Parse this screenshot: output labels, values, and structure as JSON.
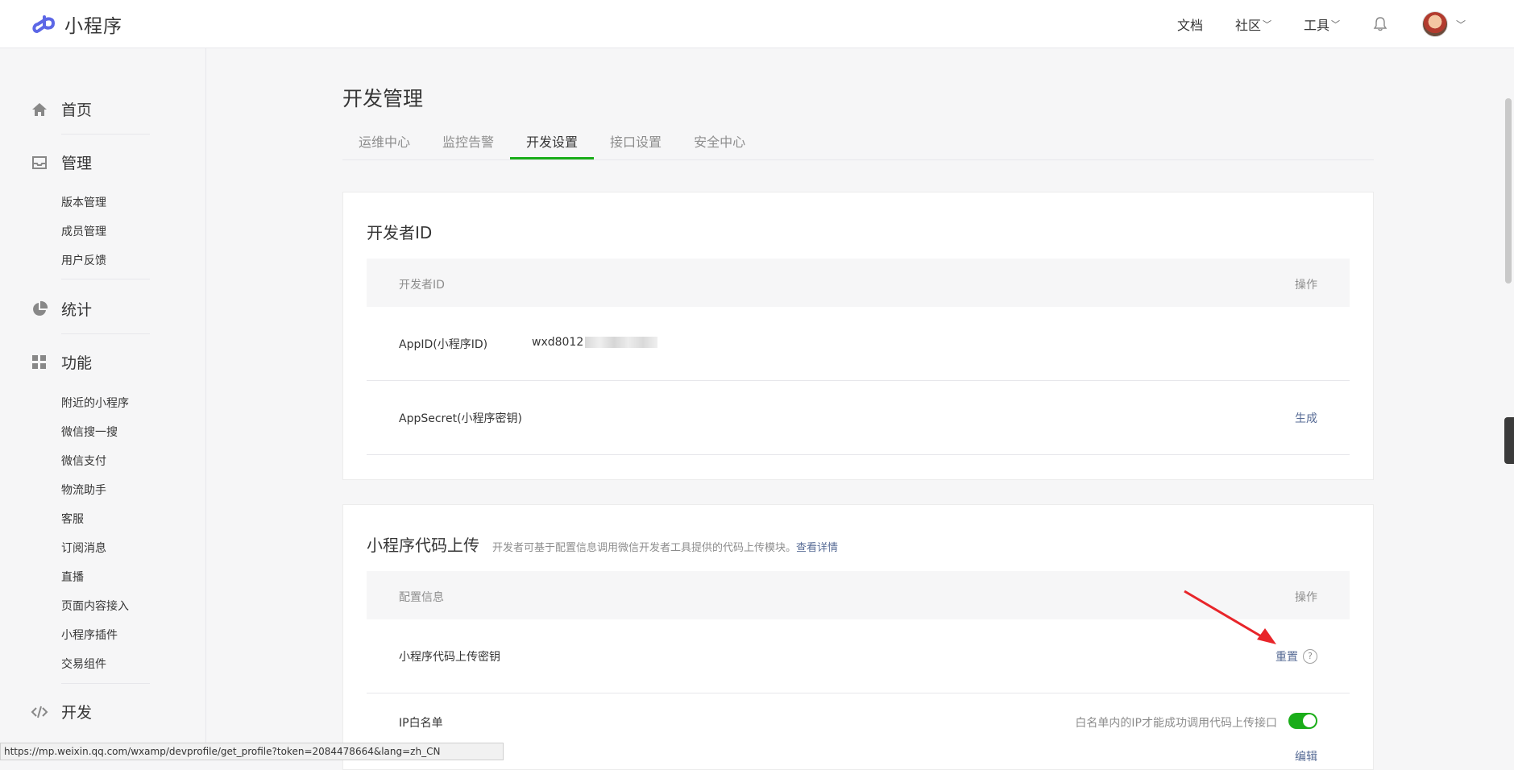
{
  "header": {
    "app_name": "小程序",
    "nav": [
      {
        "label": "文档"
      },
      {
        "label": "社区",
        "chevron": "﹀"
      },
      {
        "label": "工具",
        "chevron": "﹀"
      }
    ],
    "bell_icon": "bell-icon",
    "avatar_chevron": "﹀"
  },
  "sidebar": {
    "home": "首页",
    "manage": "管理",
    "manage_items": [
      "版本管理",
      "成员管理",
      "用户反馈"
    ],
    "stats": "统计",
    "features": "功能",
    "feature_items": [
      "附近的小程序",
      "微信搜一搜",
      "微信支付",
      "物流助手",
      "客服",
      "订阅消息",
      "直播",
      "页面内容接入",
      "小程序插件",
      "交易组件"
    ],
    "dev": "开发"
  },
  "main": {
    "title": "开发管理",
    "tabs": [
      "运维中心",
      "监控告警",
      "开发设置",
      "接口设置",
      "安全中心"
    ],
    "active_tab": 2
  },
  "dev_id_card": {
    "title": "开发者ID",
    "col_left": "开发者ID",
    "col_right": "操作",
    "appid_label": "AppID(小程序ID)",
    "appid_value": "wxd8012",
    "secret_label": "AppSecret(小程序密钥)",
    "secret_action": "生成"
  },
  "upload_card": {
    "title": "小程序代码上传",
    "desc": "开发者可基于配置信息调用微信开发者工具提供的代码上传模块。",
    "desc_link": "查看详情",
    "col_left": "配置信息",
    "col_right": "操作",
    "key_label": "小程序代码上传密钥",
    "key_action": "重置",
    "help_glyph": "?",
    "ip_label": "IP白名单",
    "ip_note": "白名单内的IP才能成功调用代码上传接口",
    "ip_toggle_on": true,
    "ip_edit": "编辑"
  },
  "annotation": {
    "color": "#e8252a"
  },
  "status_url": "https://mp.weixin.qq.com/wxamp/devprofile/get_profile?token=2084478664&lang=zh_CN"
}
